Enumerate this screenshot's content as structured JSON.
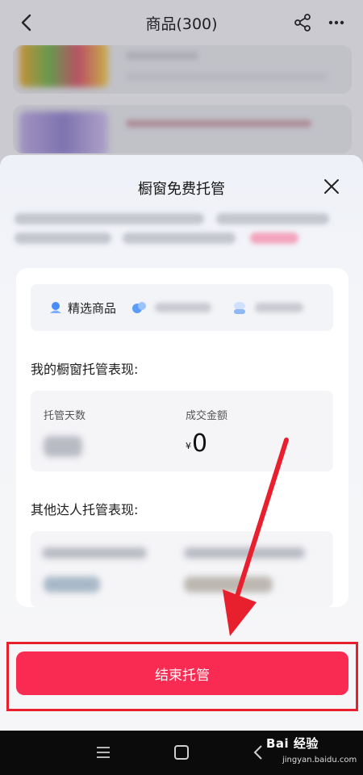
{
  "header": {
    "title": "商品(300)",
    "back_icon": "chevron-left-icon",
    "share_icon": "share-icon",
    "more_icon": "more-icon",
    "more_glyph": "···"
  },
  "sheet": {
    "title": "橱窗免费托管",
    "close_icon": "close-icon",
    "tabs": [
      {
        "label": "精选商品",
        "icon": "bag-icon"
      },
      {
        "label": "",
        "icon": "blob-icon"
      },
      {
        "label": "",
        "icon": "hat-icon"
      }
    ],
    "my_performance": {
      "title": "我的橱窗托管表现:",
      "days_label": "托管天数",
      "amount_label": "成交金额",
      "currency": "¥",
      "amount_value": "0"
    },
    "others_performance": {
      "title": "其他达人托管表现:"
    },
    "end_button": "结束托管"
  },
  "system_nav": {
    "menu_icon": "menu-icon",
    "home_icon": "home-icon",
    "back_icon": "back-icon"
  },
  "watermark": {
    "main": "Bai 经验",
    "sub": "jingyan.baidu.com"
  },
  "colors": {
    "accent": "#fa2b52",
    "highlight_frame": "#e8202e",
    "arrow": "#e8202e"
  }
}
